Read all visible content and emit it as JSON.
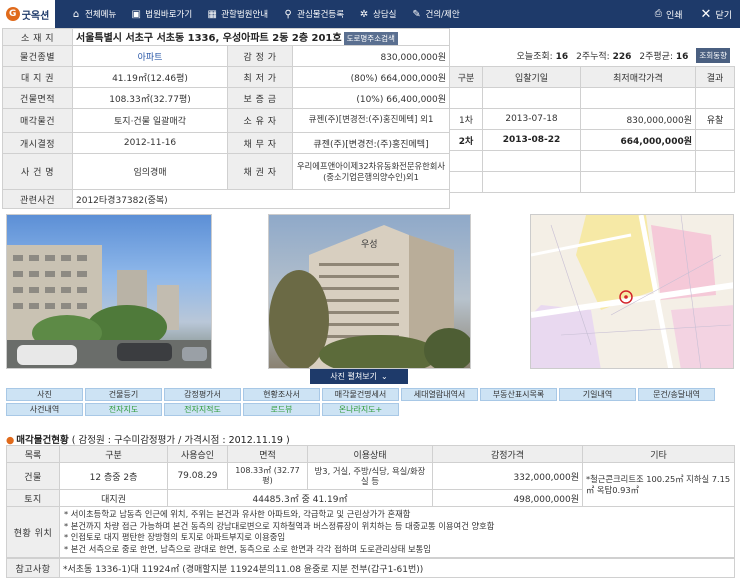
{
  "header": {
    "logo_text": "굿옥션",
    "menu": [
      {
        "icon": "home-icon",
        "label": "전체메뉴"
      },
      {
        "icon": "court-icon",
        "label": "법원바로가기"
      },
      {
        "icon": "building-icon",
        "label": "관할법원안내"
      },
      {
        "icon": "search-icon",
        "label": "관심물건등록"
      },
      {
        "icon": "gear-icon",
        "label": "상담실"
      },
      {
        "icon": "chat-icon",
        "label": "건의/제안"
      }
    ],
    "print_label": "인쇄",
    "close_label": "닫기"
  },
  "property": {
    "labels": {
      "location": "소 재 지",
      "type": "물건종별",
      "land": "대 지 권",
      "area": "건물면적",
      "sale_item": "매각물건",
      "start": "개시결정",
      "case_name": "사 건 명",
      "related": "관련사건",
      "appraisal": "감 정 가",
      "minimum": "최 저 가",
      "deposit": "보 증 금",
      "owner": "소 유 자",
      "debtor": "채 무 자",
      "creditor": "채 권 자"
    },
    "address": "서울특별시 서초구 서초동 1336, 우성아파트 2동 2층 201호",
    "road_btn": "도로명주소검색",
    "type_value": "아파트",
    "land_value": "41.19㎡(12.46평)",
    "area_value": "108.33㎡(32.77평)",
    "sale_item_value": "토지·건물 일괄매각",
    "start_value": "2012-11-16",
    "case_name_value": "임의경매",
    "related_value": "2012타경37382(중복)",
    "appraisal_value": "830,000,000원",
    "minimum_value": "(80%) 664,000,000원",
    "deposit_value": "(10%) 66,400,000원",
    "owner_value": "큐젠(주)[변경전:(주)홍진메텍] 외1",
    "debtor_value": "큐젠(주)[변경전:(주)홍진메텍]",
    "creditor_value": "우리에프앤아이제32차유동화전문유한회사(중소기업은행의양수인)외1"
  },
  "stats": {
    "today_label": "오늘조회:",
    "today": "16",
    "week2_label": "2주누적:",
    "week2": "226",
    "avg_label": "2주평균:",
    "avg": "16",
    "btn": "조회동향"
  },
  "history": {
    "headers": [
      "구분",
      "입찰기일",
      "최저매각가격",
      "결과"
    ],
    "rows": [
      [
        "1차",
        "2013-07-18",
        "830,000,000원",
        "유찰"
      ],
      [
        "2차",
        "2013-08-22",
        "664,000,000원",
        ""
      ]
    ]
  },
  "photos": {
    "map_marker": "우성",
    "more_label": "사진 펼쳐보기"
  },
  "tabs": [
    [
      "사진",
      "건물등기",
      "감정평가서",
      "현황조사서",
      "매각물건명세서",
      "세대열람내역서",
      "부동산표시목록",
      "기일내역",
      "문건/송달내역"
    ],
    [
      "사건내역",
      "전자지도",
      "전자지적도",
      "로드뷰",
      "온나라지도+"
    ]
  ],
  "appraisal_section": {
    "title": "매각물건현황",
    "subtitle": "( 감정원 : 구수미감정평가 / 가격시점 : 2012.11.19 )",
    "headers": [
      "목록",
      "구분",
      "사용승인",
      "면적",
      "이용상태",
      "감정가격",
      "기타"
    ],
    "building_row": {
      "list": "건물",
      "kind": "12 층중 2층",
      "approval": "79.08.29",
      "area": "108.33㎡ (32.77평)",
      "usage": "방3, 거실, 주방/식당, 욕실/화장실 등",
      "price": "332,000,000원",
      "etc": "*철근콘크리트조 100.25㎡ 지하실 7.15㎡ 옥탑0.93㎡"
    },
    "land_row": {
      "list": "토지",
      "kind": "대지권",
      "area": "44485.3㎡ 중 41.19㎡",
      "price": "498,000,000원"
    },
    "status_label": "현황 위치",
    "status_lines": [
      "* 서이초등학교 남동측 인근에 위치, 주위는 본건과 유사한 아파트와, 각급학교 및 근린상가가 혼재함",
      "* 본건까지 차량 접근 가능하며 본건 동측의 강남대로변으로 지하철역과 버스정류장이 위치하는 등 대중교통 이용여건 양호함",
      "* 인접토로 대지 평탄한 장방형의 토지로 아파트부지로 이용중임",
      "* 본건 서측으로 중로 한면, 남측으로 광대로 한면, 동측으로 소로 한면과 각각 접하며 도로관리상태 보통임"
    ],
    "ref_label": "참고사항",
    "ref_value": "*서초동 1336-1)대 11924㎡ (경매할지분 11924분의11.08 윤중로 지분 전부(갑구1-61번))"
  }
}
